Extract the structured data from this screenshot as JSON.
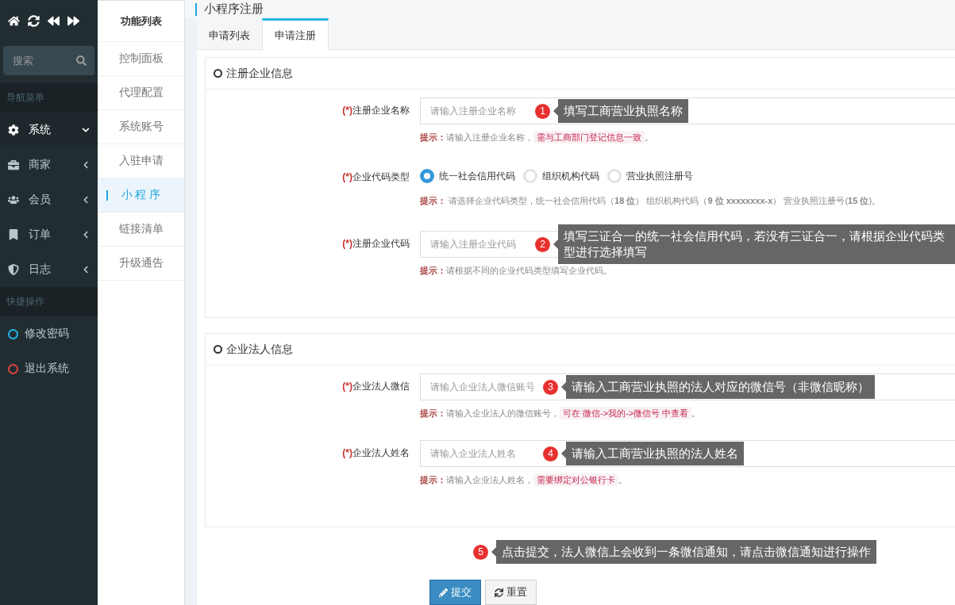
{
  "sidebar": {
    "search": {
      "placeholder": "搜索"
    },
    "nav_menu": {
      "heading": "导航菜单",
      "items": [
        {
          "label": "系统",
          "expanded": true
        },
        {
          "label": "商家",
          "expanded": false
        },
        {
          "label": "会员",
          "expanded": false
        },
        {
          "label": "订单",
          "expanded": false
        },
        {
          "label": "日志",
          "expanded": false
        }
      ]
    },
    "shortcuts": {
      "heading": "快捷操作",
      "items": [
        {
          "label": "修改密码",
          "color": "#1fb5e6"
        },
        {
          "label": "退出系统",
          "color": "#e0463c"
        }
      ]
    }
  },
  "function_list": {
    "title": "功能列表",
    "items": [
      {
        "label": "控制面板",
        "selected": false
      },
      {
        "label": "代理配置",
        "selected": false
      },
      {
        "label": "系统账号",
        "selected": false
      },
      {
        "label": "入驻申请",
        "selected": false
      },
      {
        "label": "小 程 序",
        "selected": true
      },
      {
        "label": "链接清单",
        "selected": false
      },
      {
        "label": "升级通告",
        "selected": false
      }
    ]
  },
  "page_title": "小程序注册",
  "tabs": [
    {
      "label": "申请列表",
      "selected": false
    },
    {
      "label": "申请注册",
      "selected": true
    }
  ],
  "sections": [
    {
      "title": "注册企业信息",
      "fields": [
        {
          "kind": "input",
          "required": "(*)",
          "label": "注册企业名称",
          "placeholder": "请输入注册企业名称",
          "hint": {
            "label": "提示：",
            "text": "请输入注册企业名称，",
            "highlight": "需与工商部门登记信息一致",
            "end": "。"
          },
          "callout": {
            "number": "1",
            "text": "填写工商营业执照名称"
          }
        },
        {
          "kind": "radio",
          "required": "(*)",
          "label": "企业代码类型",
          "options": [
            {
              "label": "统一社会信用代码",
              "selected": true
            },
            {
              "label": "组织机构代码",
              "selected": false
            },
            {
              "label": "营业执照注册号",
              "selected": false
            }
          ],
          "hint": {
            "label": "提示：",
            "text": " 请选择企业代码类型，统一社会信用代码（**18 位**） 组织机构代码（**9 位 xxxxxxxx-x**） 营业执照注册号(**15 位**)。"
          }
        },
        {
          "kind": "input",
          "required": "(*)",
          "label": "注册企业代码",
          "placeholder": "请输入注册企业代码",
          "hint": {
            "label": "提示：",
            "text": "请根据不同的企业代码类型填写企业代码。"
          },
          "callout": {
            "number": "2",
            "text": "填写三证合一的统一社会信用代码，若没有三证合一，请根据企业代码类型进行选择填写"
          }
        }
      ]
    },
    {
      "title": "企业法人信息",
      "fields": [
        {
          "kind": "input",
          "required": "(*)",
          "label": "企业法人微信",
          "placeholder": "请输入企业法人微信账号",
          "hint": {
            "label": "提示：",
            "text": "请输入企业法人的微信账号，",
            "highlight": "可在 微信->我的->微信号 中查看",
            "end": "。"
          },
          "callout": {
            "number": "3",
            "text": "请输入工商营业执照的法人对应的微信号（非微信昵称）"
          }
        },
        {
          "kind": "input",
          "required": "(*)",
          "label": "企业法人姓名",
          "placeholder": "请输入企业法人姓名",
          "hint": {
            "label": "提示：",
            "text": "请输入企业法人姓名，",
            "highlight": "需要绑定对公银行卡",
            "end": "。"
          },
          "callout": {
            "number": "4",
            "text": "请输入工商营业执照的法人姓名"
          }
        }
      ]
    }
  ],
  "footer": {
    "callout": {
      "number": "5",
      "text": "点击提交，法人微信上会收到一条微信通知，请点击微信通知进行操作"
    },
    "buttons": [
      {
        "kind": "primary",
        "label": "提交"
      },
      {
        "kind": "default",
        "label": "重置"
      }
    ]
  }
}
